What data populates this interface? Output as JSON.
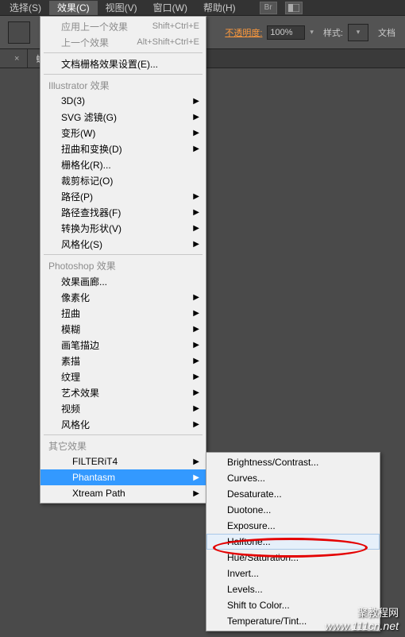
{
  "menubar": {
    "items": [
      "选择(S)",
      "效果(C)",
      "视图(V)",
      "窗口(W)",
      "帮助(H)"
    ],
    "active_index": 1,
    "br_label": "Br"
  },
  "optionsbar": {
    "opacity_label": "不透明度:",
    "opacity_value": "100%",
    "style_label": "样式:",
    "doc_label": "文档"
  },
  "tabs": [
    {
      "label": "",
      "closable": true
    },
    {
      "label": "蝴蝶",
      "closable": true
    }
  ],
  "menu": {
    "recent": [
      {
        "label": "应用上一个效果",
        "accel": "Shift+Ctrl+E",
        "enabled": false
      },
      {
        "label": "上一个效果",
        "accel": "Alt+Shift+Ctrl+E",
        "enabled": false
      }
    ],
    "document_raster": "文档栅格效果设置(E)...",
    "section_illustrator": "Illustrator 效果",
    "illustrator_items": [
      {
        "label": "3D(3)",
        "submenu": true
      },
      {
        "label": "SVG 滤镜(G)",
        "submenu": true
      },
      {
        "label": "变形(W)",
        "submenu": true
      },
      {
        "label": "扭曲和变换(D)",
        "submenu": true
      },
      {
        "label": "栅格化(R)..."
      },
      {
        "label": "裁剪标记(O)"
      },
      {
        "label": "路径(P)",
        "submenu": true
      },
      {
        "label": "路径查找器(F)",
        "submenu": true
      },
      {
        "label": "转换为形状(V)",
        "submenu": true
      },
      {
        "label": "风格化(S)",
        "submenu": true
      }
    ],
    "section_photoshop": "Photoshop 效果",
    "photoshop_items": [
      {
        "label": "效果画廊..."
      },
      {
        "label": "像素化",
        "submenu": true
      },
      {
        "label": "扭曲",
        "submenu": true
      },
      {
        "label": "模糊",
        "submenu": true
      },
      {
        "label": "画笔描边",
        "submenu": true
      },
      {
        "label": "素描",
        "submenu": true
      },
      {
        "label": "纹理",
        "submenu": true
      },
      {
        "label": "艺术效果",
        "submenu": true
      },
      {
        "label": "视频",
        "submenu": true
      },
      {
        "label": "风格化",
        "submenu": true
      }
    ],
    "section_other": "其它效果",
    "other_items": [
      {
        "label": "FILTERiT4",
        "submenu": true
      },
      {
        "label": "Phantasm",
        "submenu": true,
        "highlight": true
      },
      {
        "label": "Xtream Path",
        "submenu": true
      }
    ]
  },
  "submenu": {
    "items": [
      "Brightness/Contrast...",
      "Curves...",
      "Desaturate...",
      "Duotone...",
      "Exposure...",
      "Halftone...",
      "Hue/Saturation...",
      "Invert...",
      "Levels...",
      "Shift to Color...",
      "Temperature/Tint..."
    ],
    "hover_index": 5
  },
  "watermark": {
    "cn": "聚教程网",
    "url": "www.111cn.net"
  }
}
